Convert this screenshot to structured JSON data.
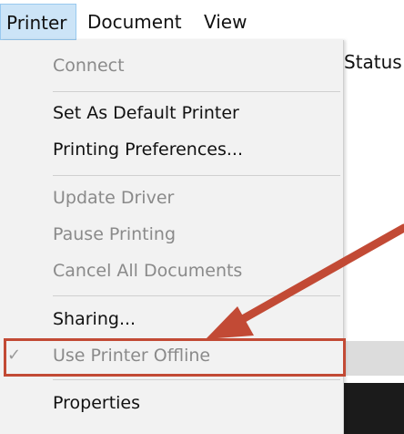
{
  "menubar": {
    "items": [
      {
        "label": "Printer"
      },
      {
        "label": "Document"
      },
      {
        "label": "View"
      }
    ]
  },
  "background": {
    "column_header": "Status"
  },
  "printer_menu": {
    "items": [
      {
        "label": "Connect",
        "enabled": false
      },
      {
        "label": "Set As Default Printer",
        "enabled": true
      },
      {
        "label": "Printing Preferences...",
        "enabled": true
      },
      {
        "label": "Update Driver",
        "enabled": false
      },
      {
        "label": "Pause Printing",
        "enabled": false
      },
      {
        "label": "Cancel All Documents",
        "enabled": false
      },
      {
        "label": "Sharing...",
        "enabled": true
      },
      {
        "label": "Use Printer Offline",
        "enabled": false,
        "checked": true,
        "check_glyph": "✓"
      },
      {
        "label": "Properties",
        "enabled": true
      }
    ]
  },
  "annotation": {
    "color": "#c24a35",
    "highlight_target": "Use Printer Offline"
  }
}
